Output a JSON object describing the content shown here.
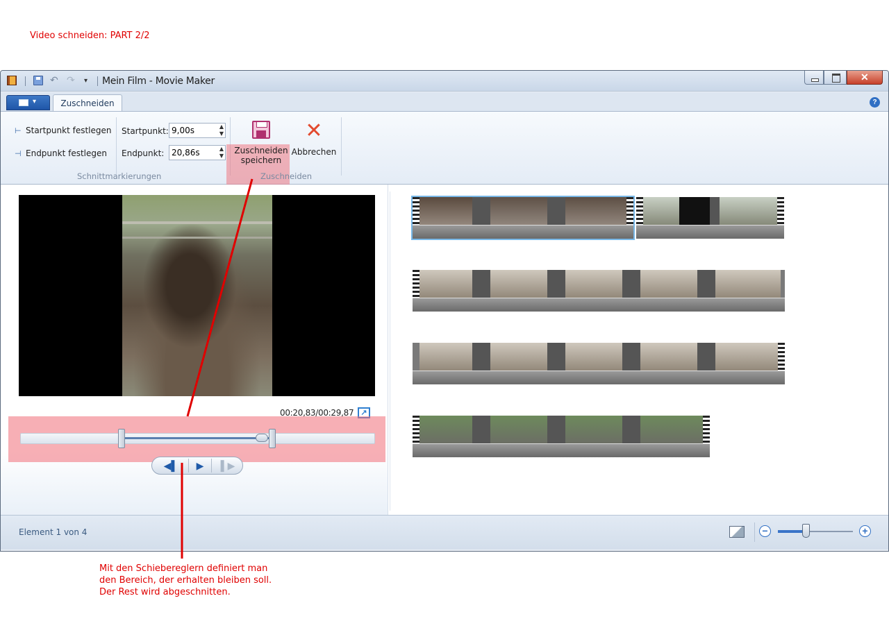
{
  "annotation": {
    "title": "Video schneiden: PART 2/2",
    "note": "Mit den Schiebereglern definiert man\nden Bereich, der erhalten bleiben soll.\nDer Rest wird abgeschnitten."
  },
  "window": {
    "title": "Mein Film - Movie Maker",
    "close_glyph": "✕"
  },
  "quick_access": {
    "undo_glyph": "↶",
    "redo_glyph": "↷",
    "more_glyph": "▾"
  },
  "tabs": {
    "file_arrow": "▾",
    "active": "Zuschneiden",
    "help": "?"
  },
  "ribbon": {
    "set_start_label": "Startpunkt festlegen",
    "set_end_label": "Endpunkt festlegen",
    "start_label": "Startpunkt:",
    "start_value": "9,00s",
    "end_label": "Endpunkt:",
    "end_value": "20,86s",
    "spin_arrows": "▲\n▼",
    "group_markers": "Schnittmarkierungen",
    "save_label": "Zuschneiden speichern",
    "cancel_label": "Abbrechen",
    "cancel_glyph": "✕",
    "group_trim": "Zuschneiden"
  },
  "player": {
    "timecode": "00:20,83/00:29,87",
    "expand_glyph": "↗",
    "prev_glyph": "◀▌",
    "play_glyph": "▶",
    "next_glyph": "▌▶"
  },
  "status": {
    "text": "Element 1 von 4",
    "zoom_out": "−",
    "zoom_in": "+"
  },
  "colors": {
    "annotation": "#e00000",
    "highlight": "#f06e78",
    "accent": "#2f6fc4"
  }
}
